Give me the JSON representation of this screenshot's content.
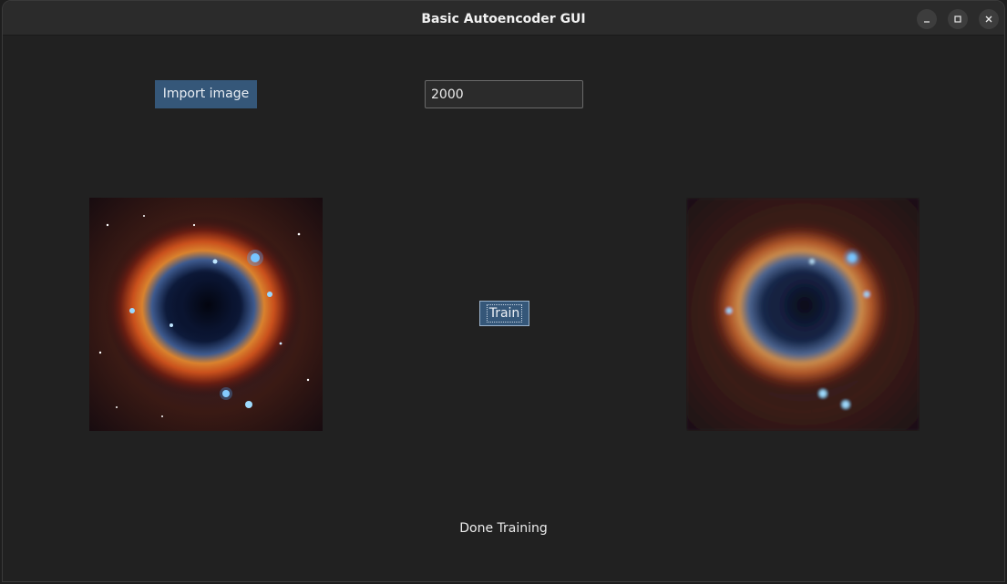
{
  "window": {
    "title": "Basic Autoencoder GUI"
  },
  "controls": {
    "import_label": "Import image",
    "iterations_value": "2000",
    "train_label": "Train"
  },
  "status": {
    "text": "Done Training"
  },
  "images": {
    "original": "helix-nebula-original",
    "reconstructed": "helix-nebula-reconstructed"
  },
  "icons": {
    "minimize": "minimize-icon",
    "maximize": "maximize-icon",
    "close": "close-icon"
  },
  "colors": {
    "button_bg": "#355779",
    "window_bg": "#212121",
    "titlebar_bg": "#2b2b2b"
  }
}
